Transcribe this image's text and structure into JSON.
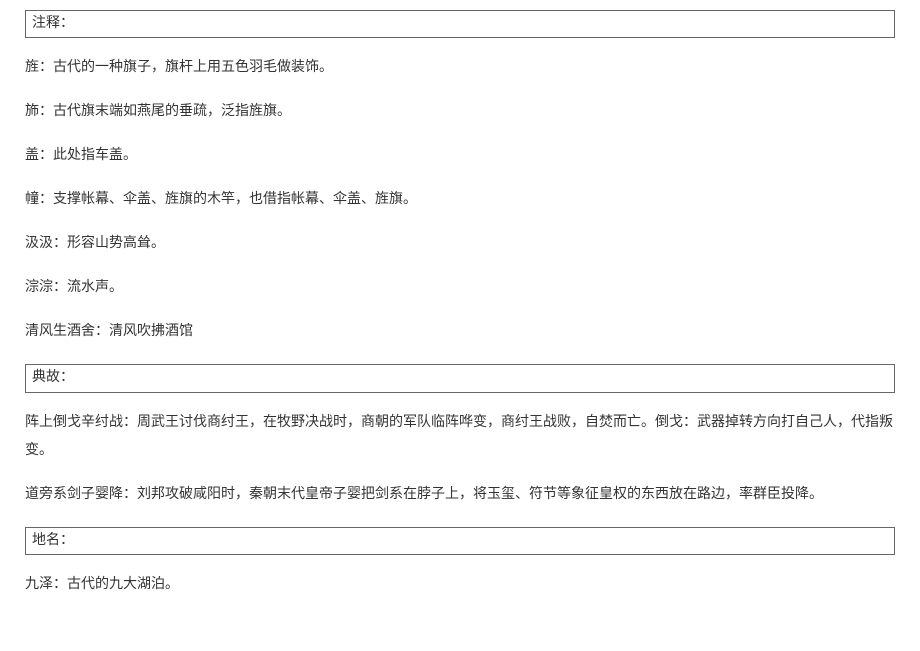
{
  "sections": [
    {
      "title": "注释：",
      "entries": [
        "旌：古代的一种旗子，旗杆上用五色羽毛做装饰。",
        "斾：古代旗末端如燕尾的垂疏，泛指旌旗。",
        "盖：此处指车盖。",
        "幢：支撑帐幕、伞盖、旌旗的木竿，也借指帐幕、伞盖、旌旗。",
        "汲汲：形容山势高耸。",
        "淙淙：流水声。",
        "清风生酒舍：清风吹拂酒馆"
      ]
    },
    {
      "title": "典故：",
      "entries": [
        "阵上倒戈辛纣战：周武王讨伐商纣王，在牧野决战时，商朝的军队临阵哗变，商纣王战败，自焚而亡。倒戈：武器掉转方向打自己人，代指叛变。",
        "道旁系剑子婴降：刘邦攻破咸阳时，秦朝末代皇帝子婴把剑系在脖子上，将玉玺、符节等象征皇权的东西放在路边，率群臣投降。"
      ]
    },
    {
      "title": "地名：",
      "entries": [
        "九泽：古代的九大湖泊。"
      ]
    }
  ]
}
